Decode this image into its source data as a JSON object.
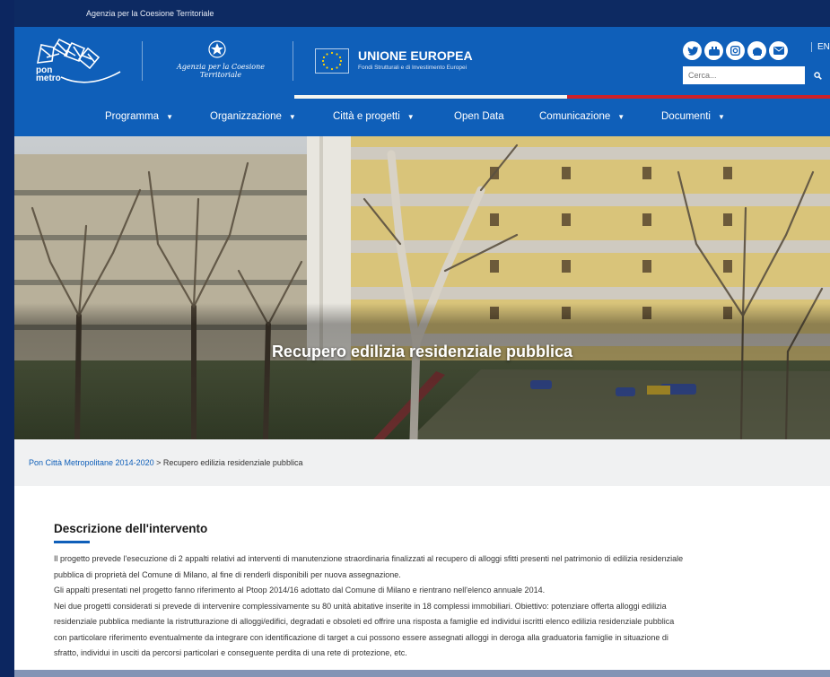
{
  "topbar": {
    "agency_link": "Agenzia per la Coesione Territoriale"
  },
  "header": {
    "logo_line1": "pon",
    "logo_line2": "metro",
    "agency_name": "Agenzia per la Coesione Territoriale",
    "eu_title": "UNIONE EUROPEA",
    "eu_subtitle": "Fondi Strutturali e di Investimento Europei",
    "social_icons": [
      "twitter-icon",
      "youtube-icon",
      "instagram-icon",
      "rss-icon",
      "email-icon"
    ],
    "lang": "EN",
    "search_placeholder": "Cerca..."
  },
  "nav": {
    "items": [
      {
        "label": "Programma"
      },
      {
        "label": "Organizzazione"
      },
      {
        "label": "Città e progetti"
      },
      {
        "label": "Open Data"
      },
      {
        "label": "Comunicazione"
      },
      {
        "label": "Documenti"
      }
    ]
  },
  "hero": {
    "title": "Recupero edilizia residenziale pubblica"
  },
  "breadcrumb": {
    "parent": "Pon Città Metropolitane 2014-2020",
    "separator": " > ",
    "current": "Recupero edilizia residenziale pubblica"
  },
  "content": {
    "heading": "Descrizione dell'intervento",
    "lines": [
      "Il progetto prevede l'esecuzione di 2 appalti relativi ad interventi di manutenzione straordinaria finalizzati al recupero di alloggi sfitti presenti nel patrimonio di edilizia residenziale",
      "pubblica di proprietà del Comune di Milano, al fine di renderli disponibili per nuova assegnazione.",
      "Gli appalti presentati nel progetto fanno riferimento al Ptoop 2014/16 adottato dal Comune di Milano e rientrano nell'elenco annuale 2014.",
      "Nei due progetti considerati si prevede di intervenire complessivamente su 80 unità abitative inserite in 18 complessi immobiliari. Obiettivo: potenziare offerta alloggi edilizia",
      "residenziale pubblica mediante la ristrutturazione di alloggi/edifici, degradati e obsoleti ed offrire una risposta a famiglie ed individui iscritti elenco edilizia residenziale pubblica",
      "con particolare riferimento eventualmente da integrare con identificazione di target a cui possono essere assegnati alloggi in deroga alla graduatoria famiglie in situazione di",
      "sfratto, individui in usciti da percorsi particolari e conseguente perdita di una rete di protezione, etc."
    ]
  },
  "colors": {
    "primary": "#0f5fb9",
    "topbar": "#0d2a62",
    "green": "#008c45",
    "white": "#f4f5f0",
    "red": "#cd212a"
  }
}
